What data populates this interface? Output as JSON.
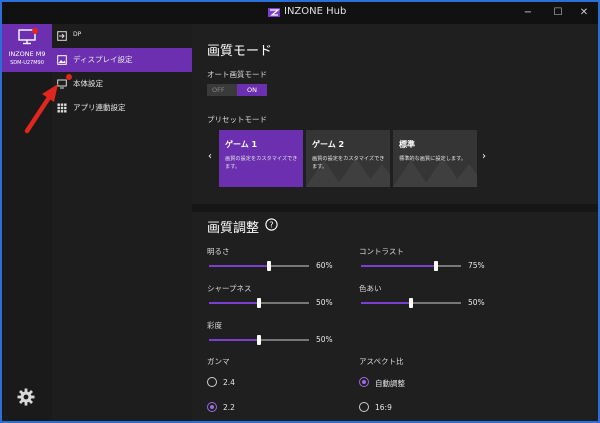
{
  "window": {
    "title": "INZONE Hub",
    "minimize": "−",
    "maximize": "☐",
    "close": "✕"
  },
  "device": {
    "name": "INZONE M9",
    "model": "SDM-U27M90"
  },
  "nav": {
    "input": "DP",
    "items": [
      {
        "label": "ディスプレイ設定",
        "icon": "image-icon",
        "active": true
      },
      {
        "label": "本体設定",
        "icon": "monitor-icon",
        "active": false
      },
      {
        "label": "アプリ連動設定",
        "icon": "apps-icon",
        "active": false
      }
    ]
  },
  "picture_mode": {
    "title": "画質モード",
    "auto_label": "オート画質モード",
    "toggle_off": "OFF",
    "toggle_on": "ON",
    "preset_label": "プリセットモード",
    "presets": [
      {
        "name": "ゲーム 1",
        "desc": "画質の設定をカスタマイズできます。",
        "selected": true
      },
      {
        "name": "ゲーム 2",
        "desc": "画質の設定をカスタマイズできます。",
        "selected": false
      },
      {
        "name": "標準",
        "desc": "標準的な画質に設定します。",
        "selected": false
      }
    ],
    "prev": "‹",
    "next": "›"
  },
  "adjust": {
    "title": "画質調整",
    "help": "?",
    "sliders": [
      {
        "label": "明るさ",
        "value_text": "60%",
        "value": 60
      },
      {
        "label": "コントラスト",
        "value_text": "75%",
        "value": 75
      },
      {
        "label": "シャープネス",
        "value_text": "50%",
        "value": 50
      },
      {
        "label": "色あい",
        "value_text": "50%",
        "value": 50
      },
      {
        "label": "彩度",
        "value_text": "50%",
        "value": 50
      }
    ],
    "gamma": {
      "label": "ガンマ",
      "options": [
        {
          "label": "2.4",
          "checked": false
        },
        {
          "label": "2.2",
          "checked": true
        }
      ]
    },
    "aspect": {
      "label": "アスペクト比",
      "options": [
        {
          "label": "自動調整",
          "checked": true
        },
        {
          "label": "16:9",
          "checked": false
        }
      ]
    }
  },
  "colors": {
    "accent": "#6b2fb0",
    "annotation": "#e0261e",
    "background": "#1f1f1f"
  }
}
